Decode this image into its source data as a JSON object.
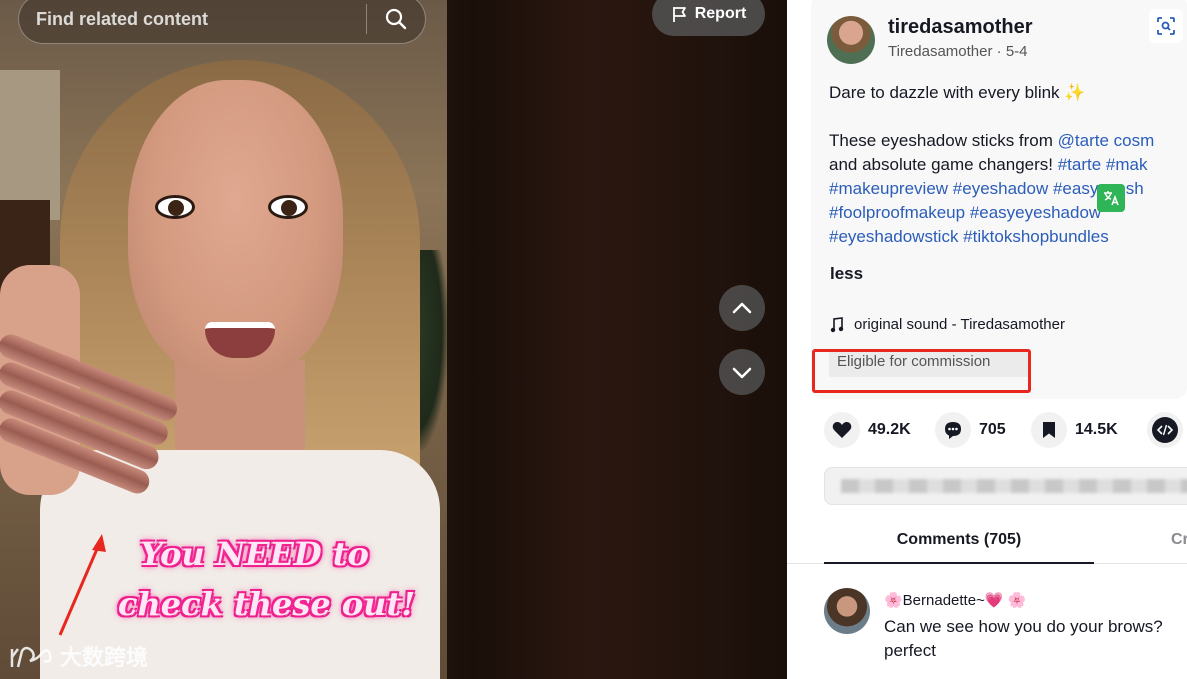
{
  "search": {
    "placeholder": "Find related content"
  },
  "report": {
    "label": "Report"
  },
  "video_overlay": {
    "line1": "You NEED to",
    "line2": "check these out!"
  },
  "watermark": {
    "text": "大数跨境"
  },
  "author": {
    "username": "tiredasamother",
    "display_name": "Tiredasamother",
    "date": "5-4",
    "meta_separator": " · "
  },
  "caption": {
    "headline": "Dare to dazzle with every blink ✨",
    "line1_prefix": "These eyeshadow sticks from ",
    "line1_mention": "@tarte cosm",
    "line2_prefix": "and absolute game changers! ",
    "line2_tags": "#tarte #mak",
    "line3_tags": "#makeupreview #eyeshadow #easyeyesh",
    "line4_tags": "#foolproofmakeup #easyeyeshadow",
    "line5_tags": "#eyeshadowstick #tiktokshopbundles",
    "less_label": "less"
  },
  "sound": {
    "label": "original sound - Tiredasamother"
  },
  "commission": {
    "label": "Eligible for commission"
  },
  "actions": {
    "likes": "49.2K",
    "comments": "705",
    "saves": "14.5K"
  },
  "tabs": {
    "comments": "Comments (705)",
    "creator": "Cr"
  },
  "comment": {
    "author": "🌸Bernadette~💗 🌸",
    "text_line1": "Can we see how you do your brows?",
    "text_line2": "perfect"
  },
  "colors": {
    "accent_link": "#2b5db9",
    "highlight_box": "#e8281f",
    "overlay_pink": "#ff2d9a"
  },
  "icons": [
    "search-icon",
    "flag-icon",
    "chevron-up-icon",
    "chevron-down-icon",
    "lens-icon",
    "translate-icon",
    "music-note-icon",
    "heart-icon",
    "comment-icon",
    "bookmark-icon",
    "embed-code-icon"
  ]
}
